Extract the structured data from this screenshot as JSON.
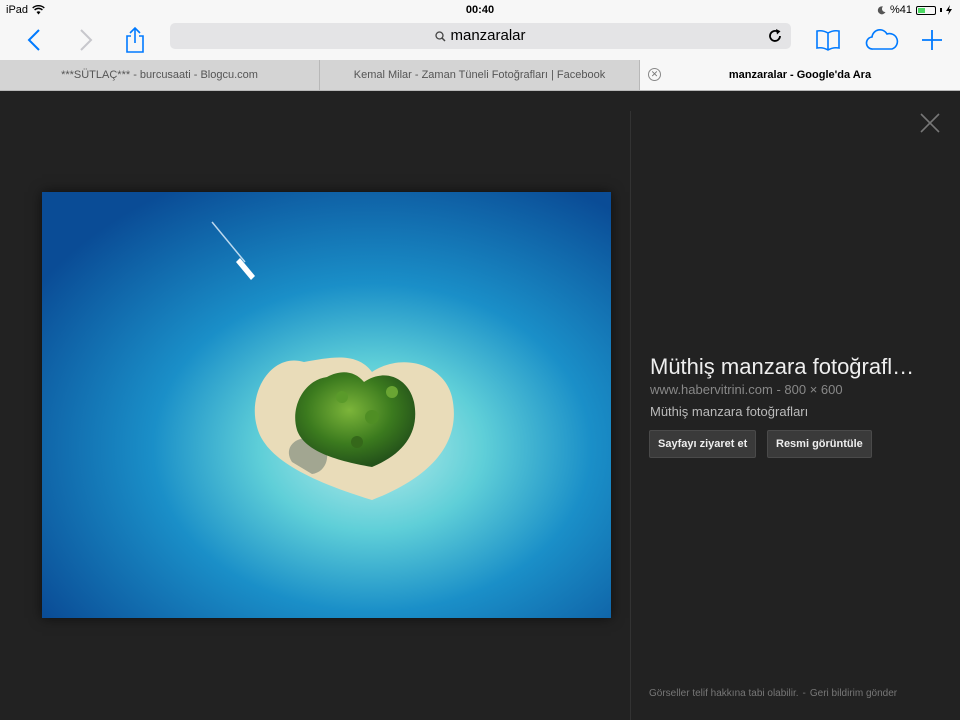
{
  "status": {
    "device": "iPad",
    "time": "00:40",
    "battery": "%41",
    "battery_level": 0.41
  },
  "toolbar": {
    "address": "manzaralar"
  },
  "tabs": [
    {
      "label": "***SÜTLAÇ*** - burcusaati - Blogcu.com"
    },
    {
      "label": "Kemal Milar - Zaman Tüneli Fotoğrafları | Facebook"
    },
    {
      "label": "manzaralar - Google'da Ara"
    }
  ],
  "result": {
    "title": "Müthiş manzara fotoğrafl…",
    "source": "www.habervitrini.com",
    "dimensions": "800 × 600",
    "description": "Müthiş manzara fotoğrafları",
    "visit_label": "Sayfayı ziyaret et",
    "view_label": "Resmi görüntüle"
  },
  "footer": {
    "copyright": "Görseller telif hakkına tabi olabilir.",
    "feedback": "Geri bildirim gönder"
  },
  "colors": {
    "accent": "#007aff",
    "bg": "#222222"
  }
}
